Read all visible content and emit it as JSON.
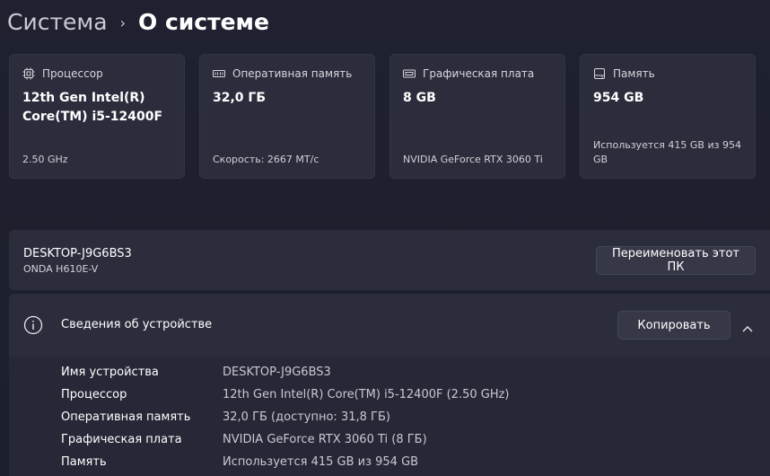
{
  "breadcrumb": {
    "parent": "Система",
    "separator": "›",
    "current": "О системе"
  },
  "cards": [
    {
      "icon": "processor-chip-icon",
      "label": "Процессор",
      "value": "12th Gen Intel(R) Core(TM) i5-12400F",
      "sub": "2.50 GHz"
    },
    {
      "icon": "memory-ram-icon",
      "label": "Оперативная память",
      "value": "32,0 ГБ",
      "sub": "Скорость: 2667 МТ/с"
    },
    {
      "icon": "graphics-card-icon",
      "label": "Графическая плата",
      "value": "8 GB",
      "sub": "NVIDIA GeForce RTX 3060 Ti"
    },
    {
      "icon": "storage-drive-icon",
      "label": "Память",
      "value": "954 GB",
      "sub": "Используется 415 GB из 954 GB"
    }
  ],
  "pc": {
    "name": "DESKTOP-J9G6BS3",
    "model": "ONDA H610E-V",
    "rename_label": "Переименовать этот ПК"
  },
  "device_info": {
    "title": "Сведения об устройстве",
    "copy_label": "Копировать",
    "rows": [
      {
        "key": "Имя устройства",
        "value": "DESKTOP-J9G6BS3"
      },
      {
        "key": "Процессор",
        "value": "12th Gen Intel(R) Core(TM) i5-12400F (2.50 GHz)"
      },
      {
        "key": "Оперативная память",
        "value": "32,0 ГБ (доступно: 31,8 ГБ)"
      },
      {
        "key": "Графическая плата",
        "value": "NVIDIA GeForce RTX 3060 Ti (8 ГБ)"
      },
      {
        "key": "Память",
        "value": "Используется 415 GB из 954 GB"
      }
    ]
  }
}
